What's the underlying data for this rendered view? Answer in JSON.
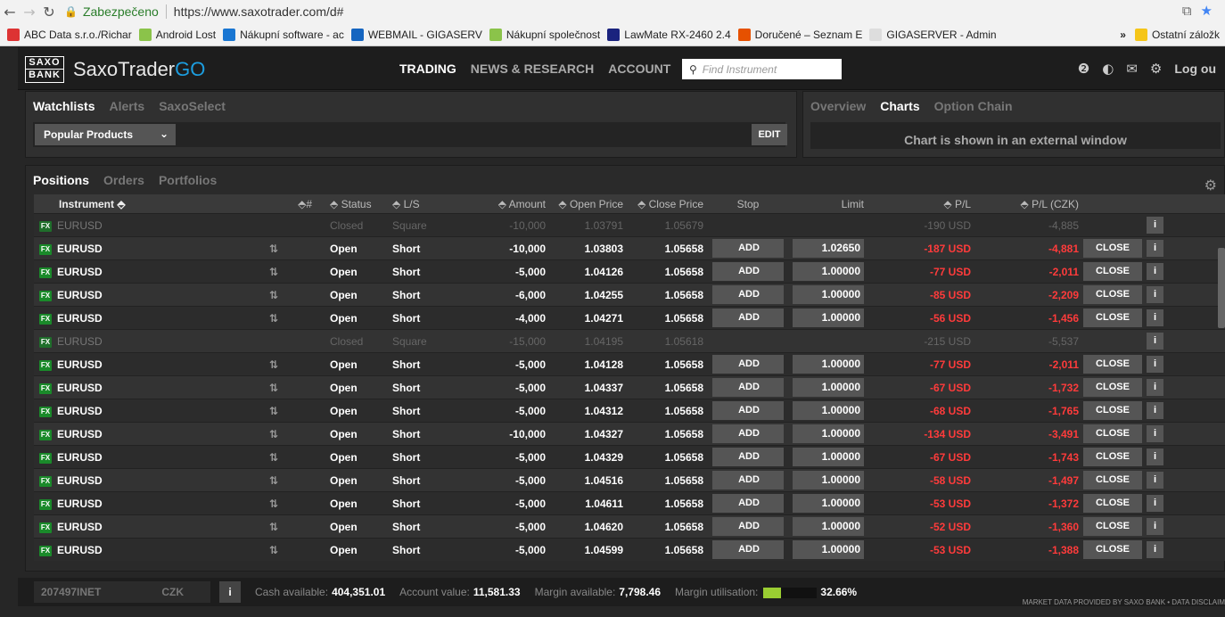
{
  "browser": {
    "secure_label": "Zabezpečeno",
    "url": "https://www.saxotrader.com/d#",
    "bookmarks": [
      {
        "label": "ABC Data s.r.o./Richar",
        "color": "#d33"
      },
      {
        "label": "Android Lost",
        "color": "#8bc34a"
      },
      {
        "label": "Nákupní software - ac",
        "color": "#1976d2"
      },
      {
        "label": "WEBMAIL - GIGASERV",
        "color": "#1565c0"
      },
      {
        "label": "Nákupní společnost",
        "color": "#8bc34a"
      },
      {
        "label": "LawMate RX-2460 2.4",
        "color": "#1a237e"
      },
      {
        "label": "Doručené – Seznam E",
        "color": "#e65100"
      },
      {
        "label": "GIGASERVER - Admin",
        "color": "#ddd"
      }
    ],
    "more": "»",
    "other_bookmarks": "Ostatní záložk"
  },
  "topbar": {
    "logo_top": "SAXO",
    "logo_bottom": "BANK",
    "brand": "SaxoTrader",
    "brand_go": "GO",
    "nav": [
      "TRADING",
      "NEWS & RESEARCH",
      "ACCOUNT"
    ],
    "search_placeholder": "Find Instrument",
    "logout": "Log ou"
  },
  "watchlist": {
    "tabs": [
      "Watchlists",
      "Alerts",
      "SaxoSelect"
    ],
    "selected": "Popular Products",
    "edit": "EDIT"
  },
  "chartpanel": {
    "tabs": [
      "Overview",
      "Charts",
      "Option Chain"
    ],
    "message": "Chart is shown in an external window"
  },
  "positions": {
    "tabs": [
      "Positions",
      "Orders",
      "Portfolios"
    ],
    "headers": {
      "instrument": "Instrument",
      "num": "# ",
      "status": "Status",
      "ls": "L/S",
      "amount": "Amount",
      "open": "Open Price",
      "close": "Close Price",
      "stop": "Stop",
      "limit": "Limit",
      "pl": "P/L",
      "plc": "P/L (CZK)"
    },
    "add_label": "ADD",
    "close_label": "CLOSE",
    "info_label": "i",
    "fx_label": "FX",
    "rows": [
      {
        "sym": "EURUSD",
        "status": "Closed",
        "ls": "Square",
        "amount": "-10,000",
        "open": "1.03791",
        "close": "1.05679",
        "limit": "",
        "pl": "-190 USD",
        "plc": "-4,885",
        "closed": true
      },
      {
        "sym": "EURUSD",
        "status": "Open",
        "ls": "Short",
        "amount": "-10,000",
        "open": "1.03803",
        "close": "1.05658",
        "limit": "1.02650",
        "pl": "-187 USD",
        "plc": "-4,881"
      },
      {
        "sym": "EURUSD",
        "status": "Open",
        "ls": "Short",
        "amount": "-5,000",
        "open": "1.04126",
        "close": "1.05658",
        "limit": "1.00000",
        "pl": "-77 USD",
        "plc": "-2,011"
      },
      {
        "sym": "EURUSD",
        "status": "Open",
        "ls": "Short",
        "amount": "-6,000",
        "open": "1.04255",
        "close": "1.05658",
        "limit": "1.00000",
        "pl": "-85 USD",
        "plc": "-2,209"
      },
      {
        "sym": "EURUSD",
        "status": "Open",
        "ls": "Short",
        "amount": "-4,000",
        "open": "1.04271",
        "close": "1.05658",
        "limit": "1.00000",
        "pl": "-56 USD",
        "plc": "-1,456"
      },
      {
        "sym": "EURUSD",
        "status": "Closed",
        "ls": "Square",
        "amount": "-15,000",
        "open": "1.04195",
        "close": "1.05618",
        "limit": "",
        "pl": "-215 USD",
        "plc": "-5,537",
        "closed": true
      },
      {
        "sym": "EURUSD",
        "status": "Open",
        "ls": "Short",
        "amount": "-5,000",
        "open": "1.04128",
        "close": "1.05658",
        "limit": "1.00000",
        "pl": "-77 USD",
        "plc": "-2,011"
      },
      {
        "sym": "EURUSD",
        "status": "Open",
        "ls": "Short",
        "amount": "-5,000",
        "open": "1.04337",
        "close": "1.05658",
        "limit": "1.00000",
        "pl": "-67 USD",
        "plc": "-1,732"
      },
      {
        "sym": "EURUSD",
        "status": "Open",
        "ls": "Short",
        "amount": "-5,000",
        "open": "1.04312",
        "close": "1.05658",
        "limit": "1.00000",
        "pl": "-68 USD",
        "plc": "-1,765"
      },
      {
        "sym": "EURUSD",
        "status": "Open",
        "ls": "Short",
        "amount": "-10,000",
        "open": "1.04327",
        "close": "1.05658",
        "limit": "1.00000",
        "pl": "-134 USD",
        "plc": "-3,491"
      },
      {
        "sym": "EURUSD",
        "status": "Open",
        "ls": "Short",
        "amount": "-5,000",
        "open": "1.04329",
        "close": "1.05658",
        "limit": "1.00000",
        "pl": "-67 USD",
        "plc": "-1,743"
      },
      {
        "sym": "EURUSD",
        "status": "Open",
        "ls": "Short",
        "amount": "-5,000",
        "open": "1.04516",
        "close": "1.05658",
        "limit": "1.00000",
        "pl": "-58 USD",
        "plc": "-1,497"
      },
      {
        "sym": "EURUSD",
        "status": "Open",
        "ls": "Short",
        "amount": "-5,000",
        "open": "1.04611",
        "close": "1.05658",
        "limit": "1.00000",
        "pl": "-53 USD",
        "plc": "-1,372"
      },
      {
        "sym": "EURUSD",
        "status": "Open",
        "ls": "Short",
        "amount": "-5,000",
        "open": "1.04620",
        "close": "1.05658",
        "limit": "1.00000",
        "pl": "-52 USD",
        "plc": "-1,360"
      },
      {
        "sym": "EURUSD",
        "status": "Open",
        "ls": "Short",
        "amount": "-5,000",
        "open": "1.04599",
        "close": "1.05658",
        "limit": "1.00000",
        "pl": "-53 USD",
        "plc": "-1,388"
      }
    ]
  },
  "footer": {
    "account": "207497INET",
    "currency": "CZK",
    "info": "i",
    "cash_label": "Cash available:",
    "cash": "404,351.01",
    "value_label": "Account value:",
    "value": "11,581.33",
    "margin_label": "Margin available:",
    "margin": "7,798.46",
    "util_label": "Margin utilisation:",
    "util": "32.66%",
    "util_fraction": 0.3266,
    "disclaimer": "MARKET DATA PROVIDED BY SAXO BANK • DATA DISCLAIM"
  },
  "colors": {
    "accent": "#1c9ee0",
    "loss": "#ff3b3b",
    "fx_badge": "#1a8a2a"
  }
}
